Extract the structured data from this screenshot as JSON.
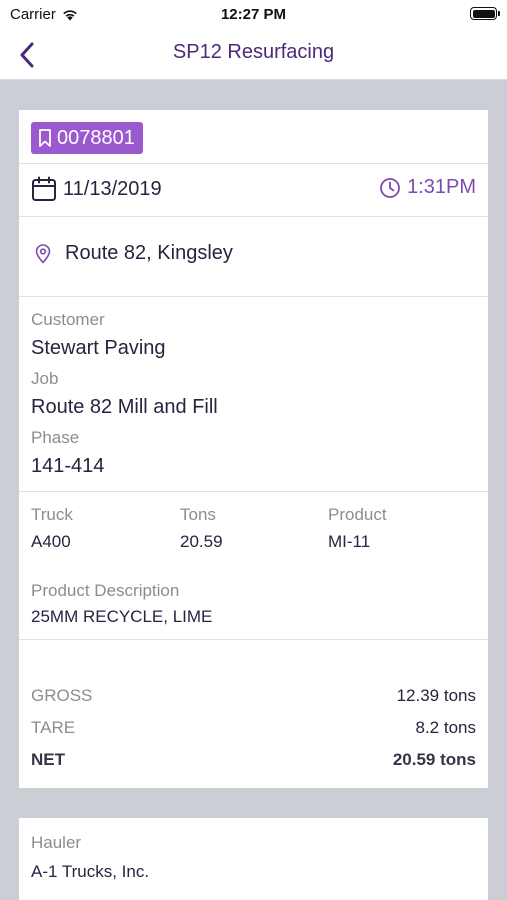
{
  "status_bar": {
    "carrier": "Carrier",
    "time": "12:27 PM"
  },
  "nav": {
    "title": "SP12 Resurfacing"
  },
  "ticket": {
    "number": "0078801",
    "date": "11/13/2019",
    "time": "1:31PM",
    "location": "Route 82, Kingsley"
  },
  "details": {
    "customer_label": "Customer",
    "customer": "Stewart Paving",
    "job_label": "Job",
    "job": "Route 82 Mill and Fill",
    "phase_label": "Phase",
    "phase": "141-414"
  },
  "load": {
    "truck_label": "Truck",
    "truck": "A400",
    "tons_label": "Tons",
    "tons": "20.59",
    "product_label": "Product",
    "product": "MI-11",
    "product_desc_label": "Product Description",
    "product_desc": "25MM RECYCLE, LIME"
  },
  "weights": {
    "gross_label": "GROSS",
    "gross": "12.39 tons",
    "tare_label": "TARE",
    "tare": "8.2 tons",
    "net_label": "NET",
    "net": "20.59 tons"
  },
  "hauler": {
    "label": "Hauler",
    "name": "A-1 Trucks, Inc."
  },
  "colors": {
    "accent": "#9b59d0",
    "title": "#4b2a7a",
    "background": "#ccced6"
  }
}
